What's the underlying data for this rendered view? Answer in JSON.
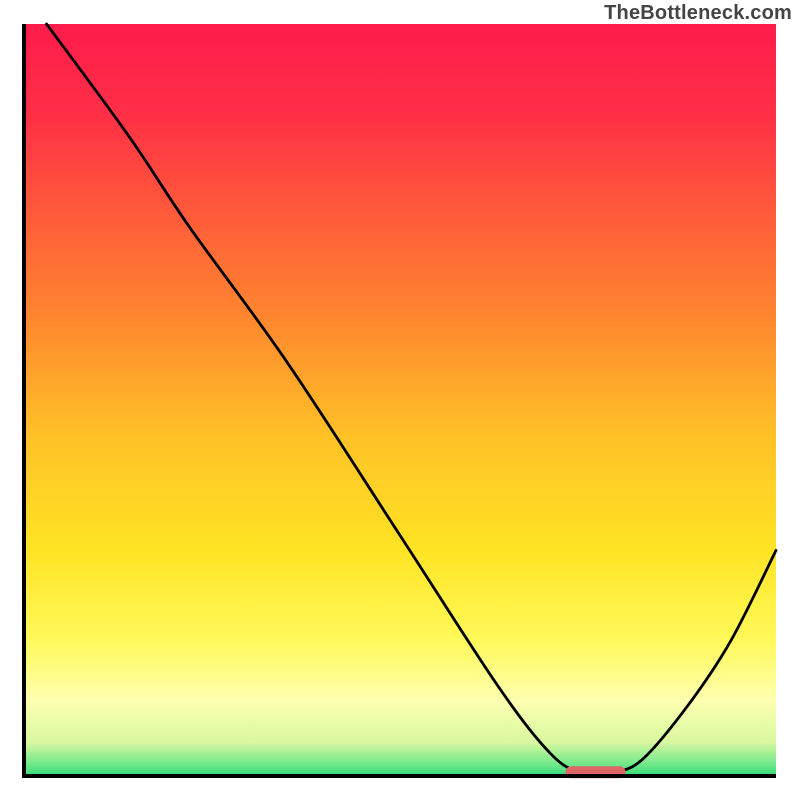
{
  "watermark": "TheBottleneck.com",
  "chart_data": {
    "type": "line",
    "title": "",
    "xlabel": "",
    "ylabel": "",
    "xlim": [
      0,
      100
    ],
    "ylim": [
      0,
      100
    ],
    "grid": false,
    "legend": false,
    "gradient_stops": [
      {
        "offset": 0.0,
        "color": "#ff1c4b"
      },
      {
        "offset": 0.12,
        "color": "#ff2f46"
      },
      {
        "offset": 0.25,
        "color": "#ff5a3a"
      },
      {
        "offset": 0.4,
        "color": "#ff8a2e"
      },
      {
        "offset": 0.55,
        "color": "#ffc226"
      },
      {
        "offset": 0.7,
        "color": "#ffe424"
      },
      {
        "offset": 0.82,
        "color": "#fff95a"
      },
      {
        "offset": 0.9,
        "color": "#fdffb0"
      },
      {
        "offset": 0.955,
        "color": "#d8f8a0"
      },
      {
        "offset": 0.985,
        "color": "#6fe88a"
      },
      {
        "offset": 1.0,
        "color": "#2fd977"
      }
    ],
    "series": [
      {
        "name": "bottleneck-curve",
        "x": [
          3,
          14,
          22,
          35,
          50,
          63,
          70,
          74,
          78,
          82,
          88,
          94,
          100
        ],
        "y": [
          100,
          85,
          73,
          55,
          32,
          12,
          3,
          0.5,
          0.5,
          2,
          9,
          18,
          30
        ]
      }
    ],
    "marker": {
      "name": "optimal-range",
      "x_start": 72,
      "x_end": 80,
      "y": 0.5,
      "color": "#e06666"
    },
    "frame": {
      "stroke": "#000000",
      "stroke_width": 4
    }
  }
}
